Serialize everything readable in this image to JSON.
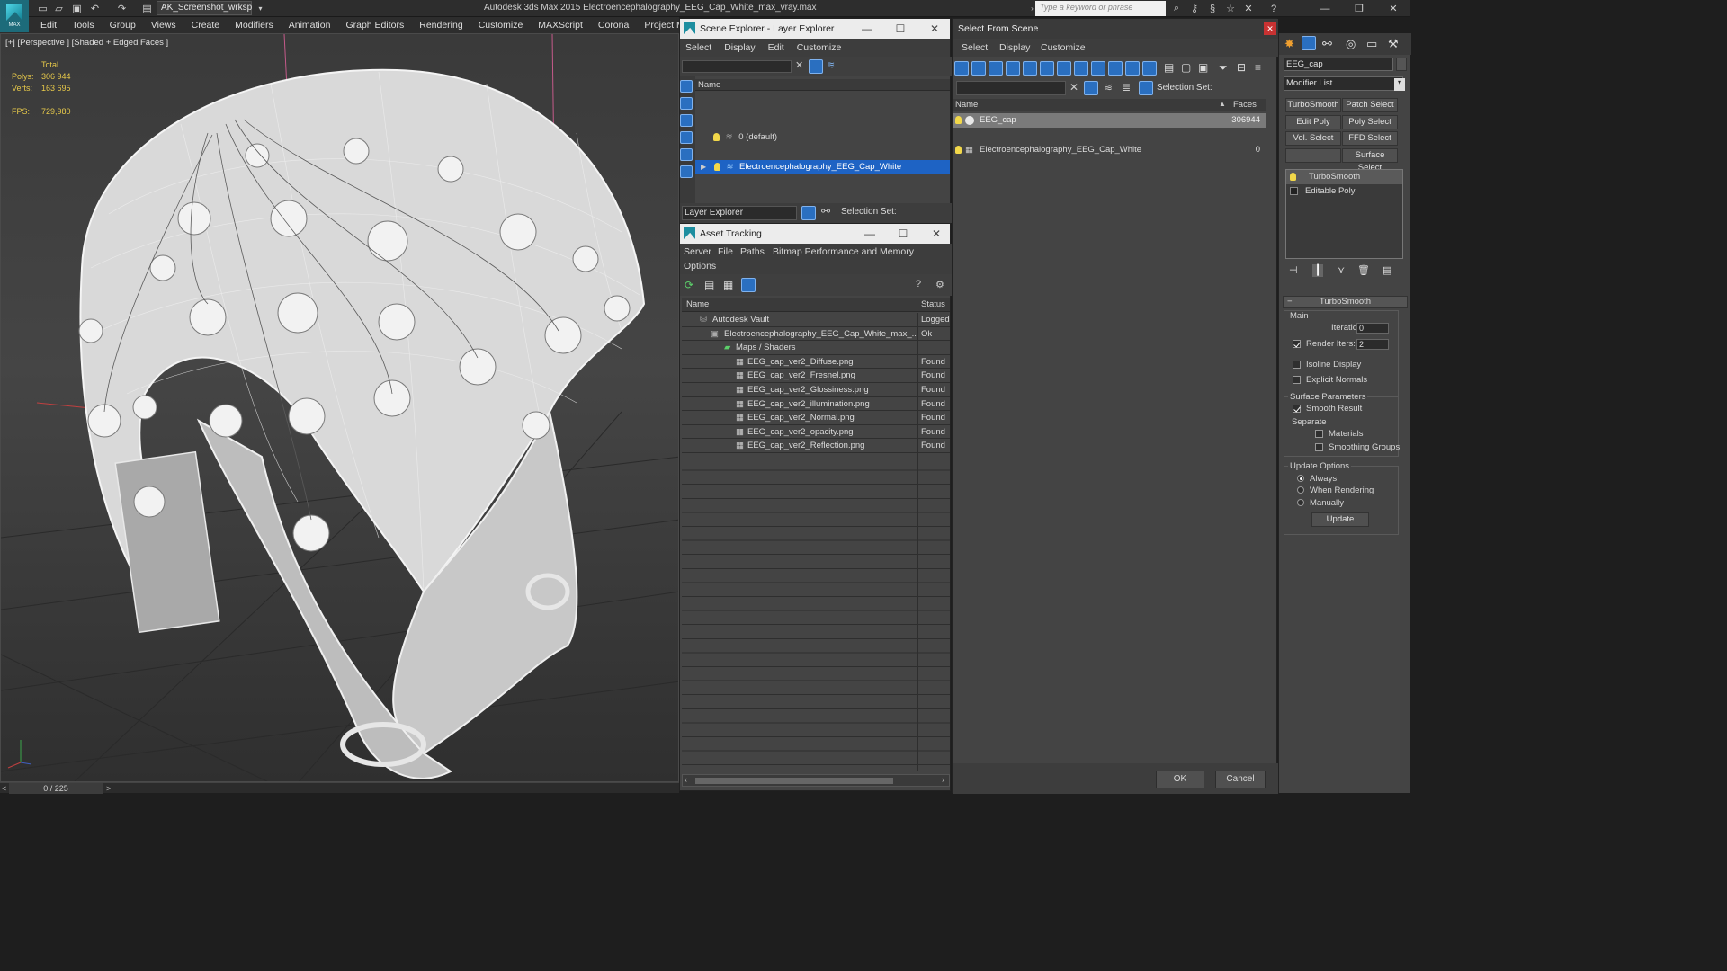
{
  "app": {
    "logo_label": "MAX",
    "workspace": "AK_Screenshot_wrksp",
    "title": "Autodesk 3ds Max  2015     Electroencephalography_EEG_Cap_White_max_vray.max",
    "search_placeholder": "Type a keyword or phrase"
  },
  "menu": [
    "Edit",
    "Tools",
    "Group",
    "Views",
    "Create",
    "Modifiers",
    "Animation",
    "Graph Editors",
    "Rendering",
    "Customize",
    "MAXScript",
    "Corona",
    "Project Man"
  ],
  "viewport": {
    "label": "[+] [Perspective ] [Shaded + Edged Faces ]",
    "stats": {
      "total_label": "Total",
      "polys_label": "Polys:",
      "polys": "306 944",
      "verts_label": "Verts:",
      "verts": "163 695",
      "fps_label": "FPS:",
      "fps": "729,980"
    }
  },
  "timeline": {
    "frame": "0 / 225",
    "prev": "<",
    "next": ">"
  },
  "scene_explorer": {
    "title": "Scene Explorer - Layer Explorer",
    "menu": [
      "Select",
      "Display",
      "Edit",
      "Customize"
    ],
    "column": "Name",
    "layers": [
      "0 (default)",
      "Electroencephalography_EEG_Cap_White"
    ],
    "footer_select": "Layer Explorer",
    "selection_set_label": "Selection Set:"
  },
  "asset_tracking": {
    "title": "Asset Tracking",
    "menu": [
      "Server",
      "File",
      "Paths",
      "Bitmap Performance and Memory"
    ],
    "menu2": "Options",
    "col_name": "Name",
    "col_status": "Status",
    "rows": [
      {
        "name": "Autodesk Vault",
        "status": "Logged"
      },
      {
        "name": "Electroencephalography_EEG_Cap_White_max_...",
        "status": "Ok"
      },
      {
        "name": "Maps / Shaders",
        "status": ""
      },
      {
        "name": "EEG_cap_ver2_Diffuse.png",
        "status": "Found"
      },
      {
        "name": "EEG_cap_ver2_Fresnel.png",
        "status": "Found"
      },
      {
        "name": "EEG_cap_ver2_Glossiness.png",
        "status": "Found"
      },
      {
        "name": "EEG_cap_ver2_illumination.png",
        "status": "Found"
      },
      {
        "name": "EEG_cap_ver2_Normal.png",
        "status": "Found"
      },
      {
        "name": "EEG_cap_ver2_opacity.png",
        "status": "Found"
      },
      {
        "name": "EEG_cap_ver2_Reflection.png",
        "status": "Found"
      }
    ]
  },
  "select_from_scene": {
    "title": "Select From Scene",
    "menu": [
      "Select",
      "Display",
      "Customize"
    ],
    "selection_set_label": "Selection Set:",
    "col_name": "Name",
    "col_faces": "Faces",
    "rows": [
      {
        "name": "EEG_cap",
        "faces": "306944"
      },
      {
        "name": "Electroencephalography_EEG_Cap_White",
        "faces": "0"
      }
    ],
    "ok": "OK",
    "cancel": "Cancel"
  },
  "command_panel": {
    "object_name": "EEG_cap",
    "modifier_list": "Modifier List",
    "buttons": [
      "TurboSmooth",
      "Patch Select",
      "Edit Poly",
      "Poly Select",
      "Vol. Select",
      "FFD Select",
      "Surface Select"
    ],
    "stack": [
      "TurboSmooth",
      "Editable Poly"
    ],
    "rollout_title": "TurboSmooth",
    "main_label": "Main",
    "iterations_label": "Iterations:",
    "iterations": "0",
    "render_iters_label": "Render Iters:",
    "render_iters": "2",
    "isoline": "Isoline Display",
    "explicit_normals": "Explicit Normals",
    "surface_params": "Surface Parameters",
    "smooth_result": "Smooth Result",
    "separate": "Separate",
    "materials": "Materials",
    "smoothing_groups": "Smoothing Groups",
    "update_options": "Update Options",
    "always": "Always",
    "when_rendering": "When Rendering",
    "manually": "Manually",
    "update": "Update"
  }
}
